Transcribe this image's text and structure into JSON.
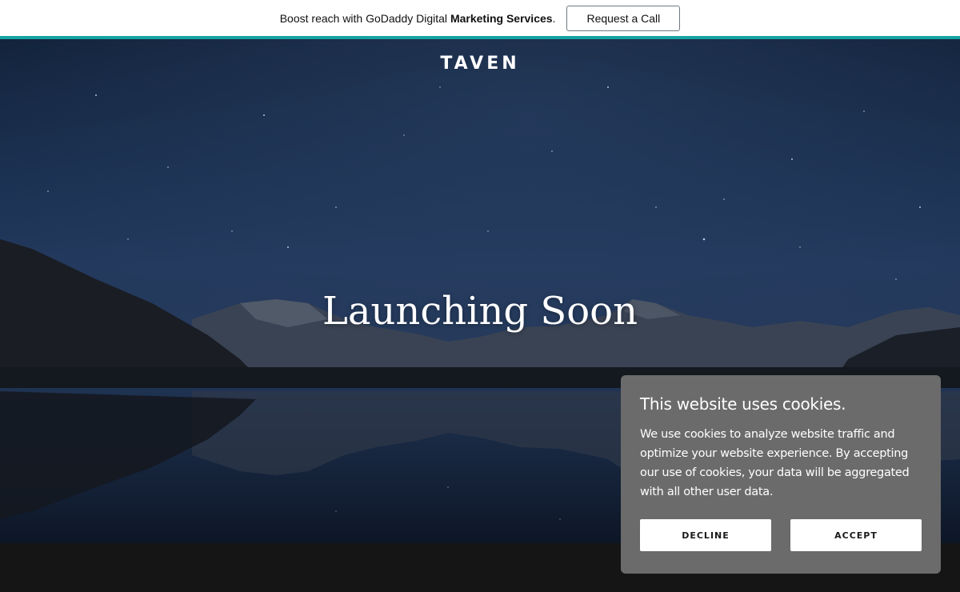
{
  "promo": {
    "text_prefix": "Boost reach with GoDaddy Digital ",
    "text_bold": "Marketing Services",
    "text_suffix": ".",
    "cta_label": "Request a Call",
    "accent_color": "#14a3a3"
  },
  "hero": {
    "logo": "TAVEN",
    "headline": "Launching Soon"
  },
  "cookie": {
    "title": "This website uses cookies.",
    "body": "We use cookies to analyze website traffic and optimize your website experience. By accepting our use of cookies, your data will be aggregated with all other user data.",
    "decline_label": "DECLINE",
    "accept_label": "ACCEPT"
  }
}
